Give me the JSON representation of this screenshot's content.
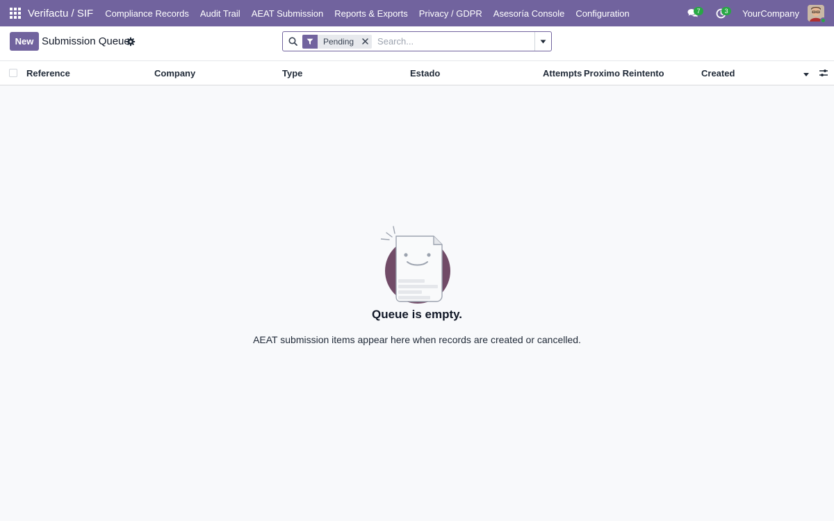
{
  "navbar": {
    "app_name": "Verifactu / SIF",
    "menu": [
      "Compliance Records",
      "Audit Trail",
      "AEAT Submission",
      "Reports & Exports",
      "Privacy / GDPR",
      "Asesoría Console",
      "Configuration"
    ],
    "messages_count": "7",
    "activities_count": "3",
    "company": "YourCompany",
    "colors": {
      "brand": "#71639e",
      "badge": "#28a745"
    }
  },
  "control_panel": {
    "new_label": "New",
    "page_title": "Submission Queue",
    "search": {
      "facet": "Pending",
      "placeholder": "Search..."
    }
  },
  "list": {
    "columns": [
      "Reference",
      "Company",
      "Type",
      "Estado",
      "Attempts",
      "Proximo Reintento",
      "Created"
    ]
  },
  "empty_state": {
    "title": "Queue is empty.",
    "description": "AEAT submission items appear here when records are created or cancelled."
  }
}
